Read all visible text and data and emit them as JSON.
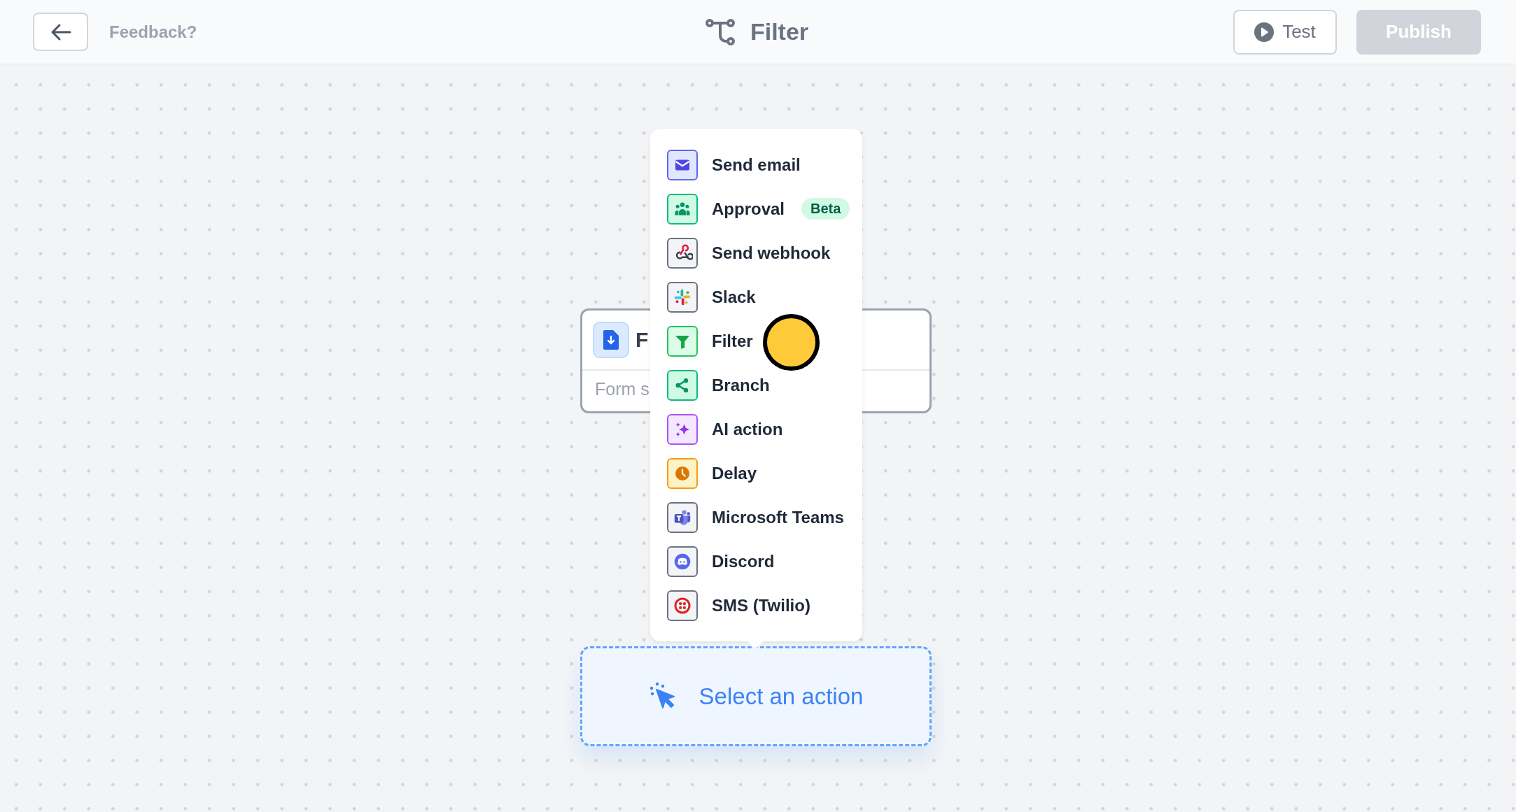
{
  "header": {
    "feedback_link": "Feedback?",
    "title": "Filter",
    "test_button": "Test",
    "publish_button": {
      "label": "Publish",
      "disabled": true
    }
  },
  "trigger_node": {
    "title": "F",
    "subtitle": "Form s"
  },
  "action_menu": {
    "items": [
      {
        "label": "Send email",
        "kind": "email"
      },
      {
        "label": "Approval",
        "kind": "approval",
        "badge": "Beta"
      },
      {
        "label": "Send webhook",
        "kind": "webhook"
      },
      {
        "label": "Slack",
        "kind": "slack"
      },
      {
        "label": "Filter",
        "kind": "filter"
      },
      {
        "label": "Branch",
        "kind": "branch"
      },
      {
        "label": "AI action",
        "kind": "ai"
      },
      {
        "label": "Delay",
        "kind": "delay"
      },
      {
        "label": "Microsoft Teams",
        "kind": "teams"
      },
      {
        "label": "Discord",
        "kind": "discord"
      },
      {
        "label": "SMS (Twilio)",
        "kind": "sms"
      }
    ]
  },
  "action_placeholder": {
    "label": "Select an action"
  }
}
